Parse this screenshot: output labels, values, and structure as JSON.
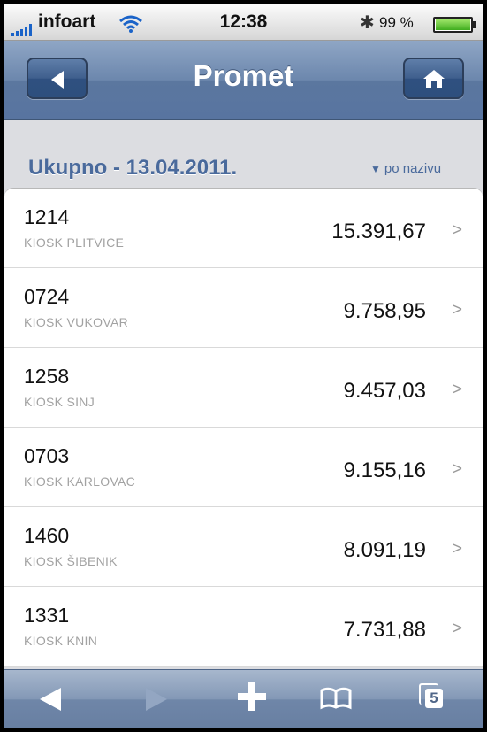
{
  "status_bar": {
    "carrier": "infoart",
    "time": "12:38",
    "bluetooth_glyph": "✱",
    "battery_pct": "99 %",
    "icons": [
      "signal-icon",
      "wifi-icon",
      "bluetooth-icon",
      "battery-icon"
    ]
  },
  "nav": {
    "title": "Promet",
    "back_icon": "back-arrow-icon",
    "home_icon": "home-icon"
  },
  "section": {
    "title": "Ukupno - 13.04.2011.",
    "sort_arrow": "▼",
    "sort_label": "po nazivu"
  },
  "rows": [
    {
      "code": "1214",
      "name": "KIOSK PLITVICE",
      "amount": "15.391,67"
    },
    {
      "code": "0724",
      "name": "KIOSK VUKOVAR",
      "amount": "9.758,95"
    },
    {
      "code": "1258",
      "name": "KIOSK SINJ",
      "amount": "9.457,03"
    },
    {
      "code": "0703",
      "name": "KIOSK KARLOVAC",
      "amount": "9.155,16"
    },
    {
      "code": "1460",
      "name": "KIOSK ŠIBENIK",
      "amount": "8.091,19"
    },
    {
      "code": "1331",
      "name": "KIOSK KNIN",
      "amount": "7.731,88"
    }
  ],
  "row_chevron": ">",
  "toolbar": {
    "pages_count": "5",
    "icons": [
      "back-icon",
      "forward-icon",
      "add-icon",
      "bookmarks-icon",
      "pages-icon"
    ]
  },
  "colors": {
    "nav_blue": "#6c87ad",
    "section_title": "#4a6a9c",
    "background": "#dcdde1"
  }
}
